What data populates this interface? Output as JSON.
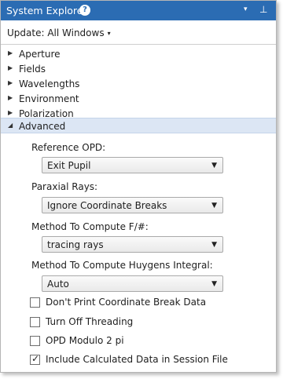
{
  "header": {
    "title": "System Explorer",
    "help_glyph": "?",
    "menu_glyph": "▾",
    "pin_glyph": "⊥"
  },
  "update": {
    "label": "Update: All Windows",
    "caret": "▾"
  },
  "sections": [
    {
      "label": "Aperture",
      "expanded": false
    },
    {
      "label": "Fields",
      "expanded": false
    },
    {
      "label": "Wavelengths",
      "expanded": false
    },
    {
      "label": "Environment",
      "expanded": false
    },
    {
      "label": "Polarization",
      "expanded": false
    },
    {
      "label": "Advanced",
      "expanded": true
    }
  ],
  "glyphs": {
    "collapsed": "▶",
    "expanded": "◢",
    "combo_arrow": "▼",
    "check": "✓"
  },
  "advanced": {
    "reference_opd": {
      "label": "Reference OPD:",
      "value": "Exit Pupil"
    },
    "paraxial_rays": {
      "label": "Paraxial Rays:",
      "value": "Ignore Coordinate Breaks"
    },
    "fnumber": {
      "label": "Method To Compute F/#:",
      "value": "tracing rays"
    },
    "huygens": {
      "label": "Method To Compute Huygens Integral:",
      "value": "Auto"
    },
    "checkboxes": [
      {
        "label": "Don't Print Coordinate Break Data",
        "checked": false
      },
      {
        "label": "Turn Off Threading",
        "checked": false
      },
      {
        "label": "OPD Modulo 2 pi",
        "checked": false
      },
      {
        "label": "Include Calculated Data in Session File",
        "checked": true
      }
    ]
  },
  "colors": {
    "titlebar": "#2b6cb3",
    "selected_row": "#dce6f4"
  }
}
